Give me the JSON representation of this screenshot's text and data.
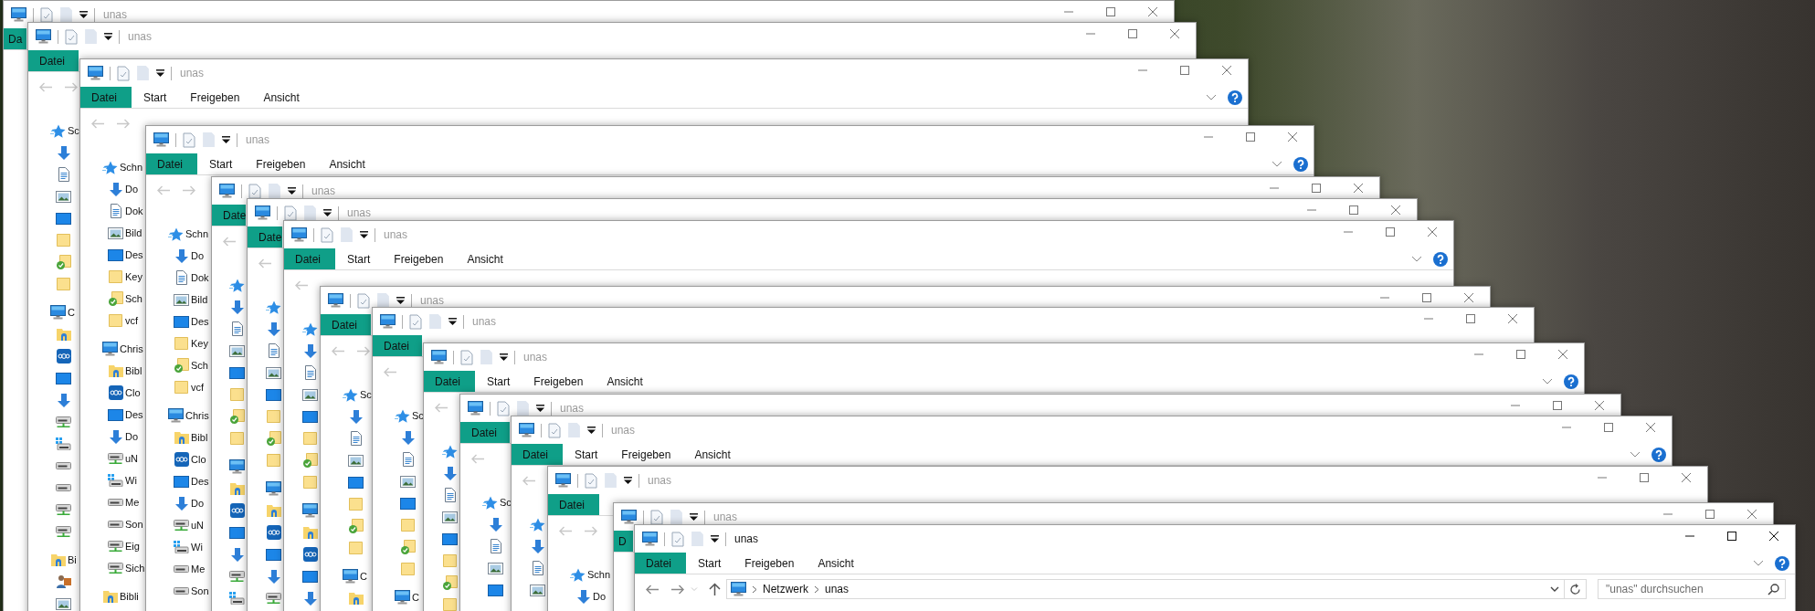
{
  "windows": [
    {
      "title": "unas",
      "active": false,
      "tabs": [
        {
          "label": "Da",
          "kind": "file"
        }
      ]
    },
    {
      "title": "unas",
      "active": false,
      "tabs": [
        {
          "label": "Datei",
          "kind": "file"
        }
      ],
      "nav": [
        {
          "label": "Sc",
          "kind": "star",
          "children": [
            {
              "kind": "download"
            },
            {
              "kind": "document"
            },
            {
              "kind": "pictures"
            },
            {
              "kind": "desktop"
            },
            {
              "kind": "folder"
            },
            {
              "kind": "folder_synced"
            },
            {
              "kind": "folder"
            }
          ]
        },
        {
          "label": "C",
          "kind": "pc",
          "children": [
            {
              "kind": "library"
            },
            {
              "kind": "cloud"
            },
            {
              "kind": "desktop"
            },
            {
              "kind": "download"
            },
            {
              "kind": "net_drive"
            },
            {
              "kind": "win_drive"
            },
            {
              "kind": "drive"
            },
            {
              "kind": "drive"
            },
            {
              "kind": "net_drive"
            },
            {
              "kind": "net_drive"
            }
          ]
        },
        {
          "label": "Bi",
          "kind": "library",
          "children": [
            {
              "kind": "user"
            },
            {
              "kind": "pictures"
            }
          ]
        }
      ]
    },
    {
      "title": "unas",
      "active": false,
      "tabs": [
        {
          "label": "Datei",
          "kind": "file"
        },
        {
          "label": "Start",
          "kind": "tab"
        },
        {
          "label": "Freigeben",
          "kind": "tab"
        },
        {
          "label": "Ansicht",
          "kind": "tab"
        }
      ],
      "nav": [
        {
          "label": "Schn",
          "kind": "star",
          "children": [
            {
              "label": "Do",
              "kind": "download"
            },
            {
              "label": "Dok",
              "kind": "document"
            },
            {
              "label": "Bild",
              "kind": "pictures"
            },
            {
              "label": "Des",
              "kind": "desktop"
            },
            {
              "label": "Key",
              "kind": "folder"
            },
            {
              "label": "Sch",
              "kind": "folder_synced"
            },
            {
              "label": "vcf",
              "kind": "folder"
            }
          ]
        },
        {
          "label": "Chris",
          "kind": "pc",
          "children": [
            {
              "label": "Bibl",
              "kind": "library"
            },
            {
              "label": "Clo",
              "kind": "cloud"
            },
            {
              "label": "Des",
              "kind": "desktop"
            },
            {
              "label": "Do",
              "kind": "download"
            },
            {
              "label": "uN",
              "kind": "net_drive"
            },
            {
              "label": "Wi",
              "kind": "win_drive"
            },
            {
              "label": "Me",
              "kind": "drive"
            },
            {
              "label": "Son",
              "kind": "drive"
            },
            {
              "label": "Eig",
              "kind": "net_drive"
            },
            {
              "label": "Sich",
              "kind": "net_drive"
            }
          ]
        },
        {
          "label": "Bibli",
          "kind": "library"
        }
      ]
    },
    {
      "title": "unas",
      "active": false,
      "tabs": [
        {
          "label": "Datei",
          "kind": "file"
        },
        {
          "label": "Start",
          "kind": "tab"
        },
        {
          "label": "Freigeben",
          "kind": "tab"
        },
        {
          "label": "Ansicht",
          "kind": "tab"
        }
      ],
      "nav": [
        {
          "label": "Schn",
          "kind": "star",
          "children": [
            {
              "label": "Do",
              "kind": "download"
            },
            {
              "label": "Dok",
              "kind": "document"
            },
            {
              "label": "Bild",
              "kind": "pictures"
            },
            {
              "label": "Des",
              "kind": "desktop"
            },
            {
              "label": "Key",
              "kind": "folder"
            },
            {
              "label": "Sch",
              "kind": "folder_synced"
            },
            {
              "label": "vcf",
              "kind": "folder"
            }
          ]
        },
        {
          "label": "Chris",
          "kind": "pc",
          "children": [
            {
              "label": "Bibl",
              "kind": "library"
            },
            {
              "label": "Clo",
              "kind": "cloud"
            },
            {
              "label": "Des",
              "kind": "desktop"
            },
            {
              "label": "Do",
              "kind": "download"
            },
            {
              "label": "uN",
              "kind": "net_drive"
            },
            {
              "label": "Wi",
              "kind": "win_drive"
            },
            {
              "label": "Me",
              "kind": "drive"
            },
            {
              "label": "Son",
              "kind": "drive"
            }
          ]
        }
      ]
    },
    {
      "title": "unas",
      "active": false,
      "tabs": [
        {
          "label": "Date",
          "kind": "file"
        }
      ],
      "nav": [
        {
          "kind": "star",
          "children": [
            {
              "kind": "download"
            },
            {
              "kind": "document"
            },
            {
              "kind": "pictures"
            },
            {
              "kind": "desktop"
            },
            {
              "kind": "folder"
            },
            {
              "kind": "folder_synced"
            },
            {
              "kind": "folder"
            }
          ]
        },
        {
          "kind": "pc",
          "children": [
            {
              "kind": "library"
            },
            {
              "kind": "cloud"
            },
            {
              "kind": "desktop"
            },
            {
              "kind": "download"
            },
            {
              "kind": "net_drive"
            },
            {
              "kind": "win_drive"
            }
          ]
        }
      ]
    },
    {
      "title": "unas",
      "active": false,
      "tabs": [
        {
          "label": "Date",
          "kind": "file"
        }
      ],
      "nav": [
        {
          "kind": "star",
          "children": [
            {
              "kind": "download"
            },
            {
              "kind": "document"
            },
            {
              "kind": "pictures"
            },
            {
              "kind": "desktop"
            },
            {
              "kind": "folder"
            },
            {
              "kind": "folder_synced"
            },
            {
              "kind": "folder"
            }
          ]
        },
        {
          "kind": "pc",
          "children": [
            {
              "kind": "library"
            },
            {
              "kind": "cloud"
            },
            {
              "kind": "desktop"
            },
            {
              "kind": "download"
            },
            {
              "kind": "net_drive"
            }
          ]
        }
      ]
    },
    {
      "title": "unas",
      "active": false,
      "tabs": [
        {
          "label": "Datei",
          "kind": "file"
        },
        {
          "label": "Start",
          "kind": "tab"
        },
        {
          "label": "Freigeben",
          "kind": "tab"
        },
        {
          "label": "Ansicht",
          "kind": "tab"
        }
      ],
      "nav": [
        {
          "kind": "star",
          "children": [
            {
              "kind": "download"
            },
            {
              "kind": "document"
            },
            {
              "kind": "pictures"
            },
            {
              "kind": "desktop"
            },
            {
              "kind": "folder"
            },
            {
              "kind": "folder_synced"
            },
            {
              "kind": "folder"
            }
          ]
        },
        {
          "kind": "pc",
          "children": [
            {
              "kind": "library"
            },
            {
              "kind": "cloud"
            },
            {
              "kind": "desktop"
            },
            {
              "kind": "download"
            }
          ]
        }
      ]
    },
    {
      "title": "unas",
      "active": false,
      "tabs": [
        {
          "label": "Datei",
          "kind": "file"
        }
      ],
      "nav": [
        {
          "label": "Sc",
          "kind": "star",
          "children": [
            {
              "kind": "download"
            },
            {
              "kind": "document"
            },
            {
              "kind": "pictures"
            },
            {
              "kind": "desktop"
            },
            {
              "kind": "folder"
            },
            {
              "kind": "folder_synced"
            },
            {
              "kind": "folder"
            }
          ]
        },
        {
          "label": "C",
          "kind": "pc",
          "children": [
            {
              "kind": "library"
            }
          ]
        }
      ]
    },
    {
      "title": "unas",
      "active": false,
      "tabs": [
        {
          "label": "Datei",
          "kind": "file"
        }
      ],
      "nav": [
        {
          "label": "Sc",
          "kind": "star",
          "children": [
            {
              "kind": "download"
            },
            {
              "kind": "document"
            },
            {
              "kind": "pictures"
            },
            {
              "kind": "desktop"
            },
            {
              "kind": "folder"
            },
            {
              "kind": "folder_synced"
            },
            {
              "kind": "folder"
            }
          ]
        },
        {
          "label": "C",
          "kind": "pc"
        }
      ]
    },
    {
      "title": "unas",
      "active": false,
      "tabs": [
        {
          "label": "Datei",
          "kind": "file"
        },
        {
          "label": "Start",
          "kind": "tab"
        },
        {
          "label": "Freigeben",
          "kind": "tab"
        },
        {
          "label": "Ansicht",
          "kind": "tab"
        }
      ],
      "nav": [
        {
          "kind": "star",
          "children": [
            {
              "kind": "download"
            },
            {
              "kind": "document"
            },
            {
              "kind": "pictures"
            },
            {
              "kind": "desktop"
            },
            {
              "kind": "folder"
            },
            {
              "kind": "folder_synced"
            },
            {
              "kind": "folder"
            }
          ]
        }
      ]
    },
    {
      "title": "unas",
      "active": false,
      "tabs": [
        {
          "label": "Datei",
          "kind": "file"
        }
      ],
      "nav": [
        {
          "label": "Sc",
          "kind": "star",
          "children": [
            {
              "kind": "download"
            },
            {
              "kind": "document"
            },
            {
              "kind": "pictures"
            },
            {
              "kind": "desktop"
            }
          ]
        }
      ]
    },
    {
      "title": "unas",
      "active": false,
      "tabs": [
        {
          "label": "Datei",
          "kind": "file"
        },
        {
          "label": "Start",
          "kind": "tab"
        },
        {
          "label": "Freigeben",
          "kind": "tab"
        },
        {
          "label": "Ansicht",
          "kind": "tab"
        }
      ],
      "nav": [
        {
          "kind": "star",
          "children": [
            {
              "kind": "download"
            },
            {
              "kind": "document"
            },
            {
              "kind": "pictures"
            }
          ]
        }
      ]
    },
    {
      "title": "unas",
      "active": false,
      "tabs": [
        {
          "label": "Datei",
          "kind": "file"
        }
      ],
      "nav": [
        {
          "label": "Schn",
          "kind": "star",
          "children": [
            {
              "label": "Do",
              "kind": "download"
            }
          ]
        }
      ]
    },
    {
      "title": "unas",
      "active": false,
      "tabs": [
        {
          "label": "D",
          "kind": "file"
        }
      ]
    },
    {
      "title": "unas",
      "active": true,
      "tabs": [
        {
          "label": "Datei",
          "kind": "file"
        },
        {
          "label": "Start",
          "kind": "tab"
        },
        {
          "label": "Freigeben",
          "kind": "tab"
        },
        {
          "label": "Ansicht",
          "kind": "tab"
        }
      ],
      "address": {
        "crumbs": [
          "Netzwerk",
          "unas"
        ]
      },
      "search": {
        "placeholder": "\"unas\" durchsuchen"
      }
    }
  ]
}
